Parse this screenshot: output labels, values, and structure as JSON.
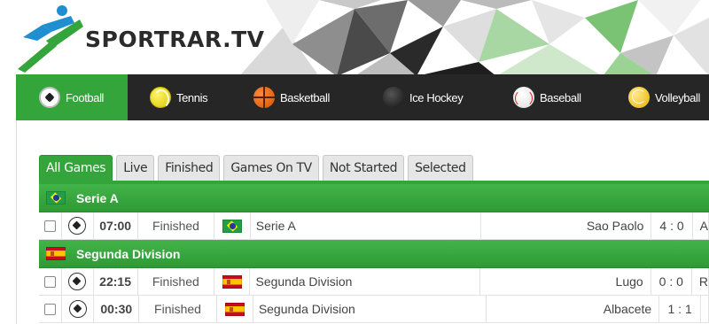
{
  "site": {
    "name": "SPORTRAR.TV"
  },
  "sports": [
    {
      "label": "Football",
      "icon": "football-icon",
      "active": true
    },
    {
      "label": "Tennis",
      "icon": "tennis-icon",
      "active": false
    },
    {
      "label": "Basketball",
      "icon": "basketball-icon",
      "active": false
    },
    {
      "label": "Ice Hockey",
      "icon": "ice-hockey-icon",
      "active": false
    },
    {
      "label": "Baseball",
      "icon": "baseball-icon",
      "active": false
    },
    {
      "label": "Volleyball",
      "icon": "volleyball-icon",
      "active": false
    }
  ],
  "tabs": [
    {
      "label": "All Games",
      "active": true
    },
    {
      "label": "Live",
      "active": false
    },
    {
      "label": "Finished",
      "active": false
    },
    {
      "label": "Games On TV",
      "active": false
    },
    {
      "label": "Not Started",
      "active": false
    },
    {
      "label": "Selected",
      "active": false
    }
  ],
  "leagues": [
    {
      "name": "Serie A",
      "flag": "brazil-flag",
      "matches": [
        {
          "time": "07:00",
          "status": "Finished",
          "league": "Serie A",
          "home": "Sao Paolo",
          "score": "4 : 0",
          "away": "A"
        }
      ]
    },
    {
      "name": "Segunda Division",
      "flag": "spain-flag",
      "matches": [
        {
          "time": "22:15",
          "status": "Finished",
          "league": "Segunda Division",
          "home": "Lugo",
          "score": "0 : 0",
          "away": "R"
        },
        {
          "time": "00:30",
          "status": "Finished",
          "league": "Segunda Division",
          "home": "Albacete",
          "score": "1 : 1",
          "away": ""
        }
      ]
    }
  ],
  "colors": {
    "accent": "#33a53a",
    "nav_bg": "#262626",
    "logo_blue": "#1f8fd0",
    "logo_green": "#33a53a"
  }
}
